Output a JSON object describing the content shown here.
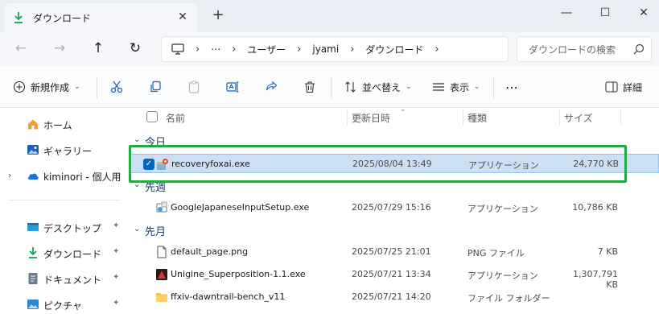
{
  "window": {
    "tab_title": "ダウンロード",
    "close_glyph": "✕",
    "new_tab_glyph": "+",
    "minimize_glyph": "—",
    "maximize_glyph": "☐",
    "close_window_glyph": "✕"
  },
  "address": {
    "back_glyph": "←",
    "forward_glyph": "→",
    "up_glyph": "↑",
    "refresh_glyph": "↻",
    "ellipsis": "⋯",
    "separator": "›",
    "crumbs": [
      "ユーザー",
      "jyami",
      "ダウンロード"
    ],
    "search_placeholder": "ダウンロードの検索"
  },
  "commands": {
    "new_label": "新規作成",
    "sort_label": "並べ替え",
    "view_label": "表示",
    "more_glyph": "⋯",
    "details_label": "詳細"
  },
  "sidebar": {
    "items": [
      {
        "label": "ホーム"
      },
      {
        "label": "ギャラリー"
      },
      {
        "label": "kiminori - 個人用"
      },
      {
        "label": "デスクトップ"
      },
      {
        "label": "ダウンロード"
      },
      {
        "label": "ドキュメント"
      },
      {
        "label": "ピクチャ"
      }
    ],
    "expand_glyph": "›",
    "pin_glyph": "📌"
  },
  "columns": {
    "name": "名前",
    "date": "更新日時",
    "type": "種類",
    "size": "サイズ"
  },
  "groups": {
    "today": "今日",
    "last_week": "先週",
    "last_month": "先月",
    "caret": "⌄"
  },
  "files": [
    {
      "name": "recoveryfoxai.exe",
      "date": "2025/08/04 13:49",
      "type": "アプリケーション",
      "size": "24,770 KB",
      "icon": "installer-icon",
      "selected": true
    },
    {
      "name": "GoogleJapaneseInputSetup.exe",
      "date": "2025/07/29 15:16",
      "type": "アプリケーション",
      "size": "10,786 KB",
      "icon": "setup-icon",
      "selected": false
    },
    {
      "name": "default_page.png",
      "date": "2025/07/25 21:01",
      "type": "PNG ファイル",
      "size": "7 KB",
      "icon": "png-file-icon",
      "selected": false
    },
    {
      "name": "Unigine_Superposition-1.1.exe",
      "date": "2025/07/21 13:34",
      "type": "アプリケーション",
      "size": "1,307,791 KB",
      "icon": "unigine-icon",
      "selected": false
    },
    {
      "name": "ffxiv-dawntrail-bench_v11",
      "date": "2025/07/21 14:20",
      "type": "ファイル フォルダー",
      "size": "",
      "icon": "folder-icon",
      "selected": false
    }
  ],
  "colors": {
    "accent": "#0067c0",
    "highlight": "#27a844",
    "selection": "#cce0f5"
  }
}
